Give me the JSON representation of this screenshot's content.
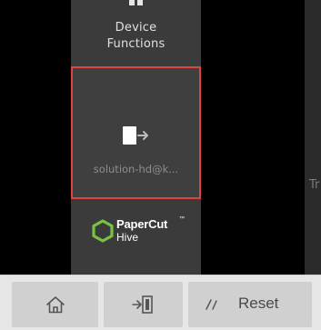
{
  "sidebar": {
    "device_functions_label": "Device\nFunctions",
    "account_tile": {
      "label": "solution-hd@k..."
    },
    "logo": {
      "line1": "PaperCut",
      "tm": "™",
      "line2": "Hive"
    }
  },
  "content": {
    "partial_label": "Tr"
  },
  "toolbar": {
    "reset_label": "Reset"
  },
  "colors": {
    "selection_border": "#e0453c",
    "logo_green": "#7ac143",
    "sidebar_bg": "#3b3b3b",
    "toolbar_bg": "#e6e6e6"
  }
}
